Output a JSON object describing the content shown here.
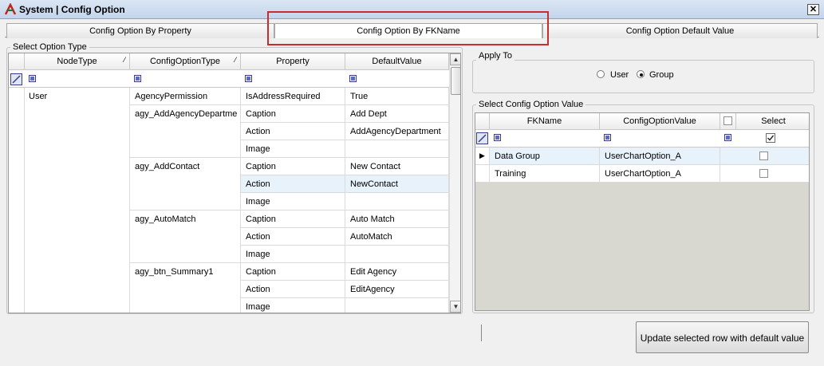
{
  "window": {
    "title": "System | Config Option",
    "close_glyph": "✕"
  },
  "tabs": [
    {
      "label": "Config Option By Property"
    },
    {
      "label": "Config Option By FKName"
    },
    {
      "label": "Config Option Default Value"
    }
  ],
  "left_panel": {
    "group_label": "Select Option Type",
    "columns": [
      "NodeType",
      "ConfigOptionType",
      "Property",
      "DefaultValue"
    ],
    "nodetype": "User",
    "groups": [
      {
        "type": "AgencyPermission",
        "rows": [
          {
            "property": "IsAddressRequired",
            "value": "True"
          }
        ]
      },
      {
        "type": "agy_AddAgencyDepartme",
        "rows": [
          {
            "property": "Caption",
            "value": "Add Dept"
          },
          {
            "property": "Action",
            "value": "AddAgencyDepartment"
          },
          {
            "property": "Image",
            "value": ""
          }
        ]
      },
      {
        "type": "agy_AddContact",
        "rows": [
          {
            "property": "Caption",
            "value": "New Contact"
          },
          {
            "property": "Action",
            "value": "NewContact"
          },
          {
            "property": "Image",
            "value": ""
          }
        ]
      },
      {
        "type": "agy_AutoMatch",
        "rows": [
          {
            "property": "Caption",
            "value": "Auto Match"
          },
          {
            "property": "Action",
            "value": "AutoMatch"
          },
          {
            "property": "Image",
            "value": ""
          }
        ]
      },
      {
        "type": "agy_btn_Summary1",
        "rows": [
          {
            "property": "Caption",
            "value": "Edit Agency"
          },
          {
            "property": "Action",
            "value": "EditAgency"
          },
          {
            "property": "Image",
            "value": ""
          }
        ]
      }
    ]
  },
  "apply_to": {
    "group_label": "Apply To",
    "options": [
      {
        "label": "User",
        "selected": false
      },
      {
        "label": "Group",
        "selected": true
      }
    ]
  },
  "right_panel": {
    "group_label": "Select Config Option Value",
    "columns": [
      "FKName",
      "ConfigOptionValue",
      "Select"
    ],
    "rows": [
      {
        "fkname": "Data Group",
        "value": "UserChartOption_A",
        "selected": false,
        "current": true
      },
      {
        "fkname": "Training",
        "value": "UserChartOption_A",
        "selected": false,
        "current": false
      }
    ]
  },
  "actions": {
    "update_button": "Update selected row with default value"
  },
  "colors": {
    "highlight": "#cc2b2b",
    "selected_row": "#e8f2fb",
    "title_gradient": "#c4d5ec"
  }
}
